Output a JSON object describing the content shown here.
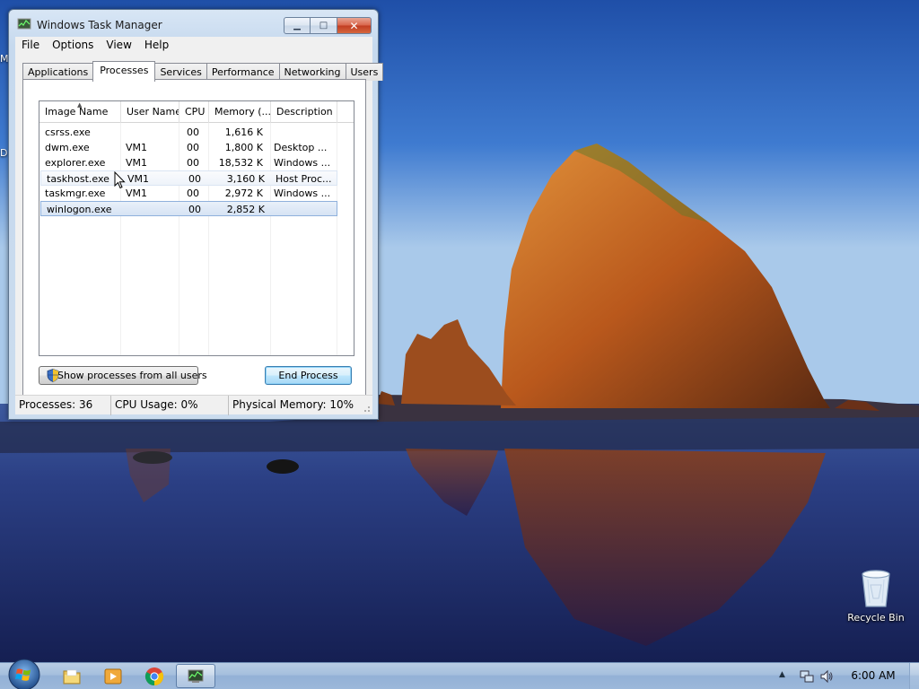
{
  "window": {
    "title": "Windows Task Manager",
    "buttons": {
      "minimize": "▁",
      "maximize": "□",
      "close": "✕"
    }
  },
  "menu": [
    "File",
    "Options",
    "View",
    "Help"
  ],
  "tabs": [
    "Applications",
    "Processes",
    "Services",
    "Performance",
    "Networking",
    "Users"
  ],
  "active_tab": "Processes",
  "columns": [
    "Image Name",
    "User Name",
    "CPU",
    "Memory (...",
    "Description"
  ],
  "processes": [
    {
      "name": "csrss.exe",
      "user": "",
      "cpu": "00",
      "memory": "1,616 K",
      "description": ""
    },
    {
      "name": "dwm.exe",
      "user": "VM1",
      "cpu": "00",
      "memory": "1,800 K",
      "description": "Desktop ..."
    },
    {
      "name": "explorer.exe",
      "user": "VM1",
      "cpu": "00",
      "memory": "18,532 K",
      "description": "Windows ..."
    },
    {
      "name": "taskhost.exe",
      "user": "VM1",
      "cpu": "00",
      "memory": "3,160 K",
      "description": "Host Proc..."
    },
    {
      "name": "taskmgr.exe",
      "user": "VM1",
      "cpu": "00",
      "memory": "2,972 K",
      "description": "Windows ..."
    },
    {
      "name": "winlogon.exe",
      "user": "",
      "cpu": "00",
      "memory": "2,852 K",
      "description": ""
    }
  ],
  "hovered_row": "taskhost.exe",
  "selected_row": "winlogon.exe",
  "buttons": {
    "show_all": "Show processes from all users",
    "end_process": "End Process"
  },
  "status": {
    "processes": "Processes: 36",
    "cpu": "CPU Usage: 0%",
    "memory": "Physical Memory: 10%"
  },
  "desktop": {
    "edge_chars": [
      "M",
      "D"
    ],
    "icons": [
      {
        "label": "Recycle Bin",
        "icon": "recycle-bin-icon"
      }
    ]
  },
  "taskbar": {
    "apps": [
      "windows-explorer-icon",
      "media-player-icon",
      "chrome-icon",
      "task-manager-icon"
    ],
    "clock": "6:00 AM",
    "tray_arrow": "▲"
  },
  "colors": {
    "sky": "#2a5db8",
    "rock": "#c2601e",
    "selection": "#d6e3f4",
    "taskbar": "#a5bfdd"
  }
}
